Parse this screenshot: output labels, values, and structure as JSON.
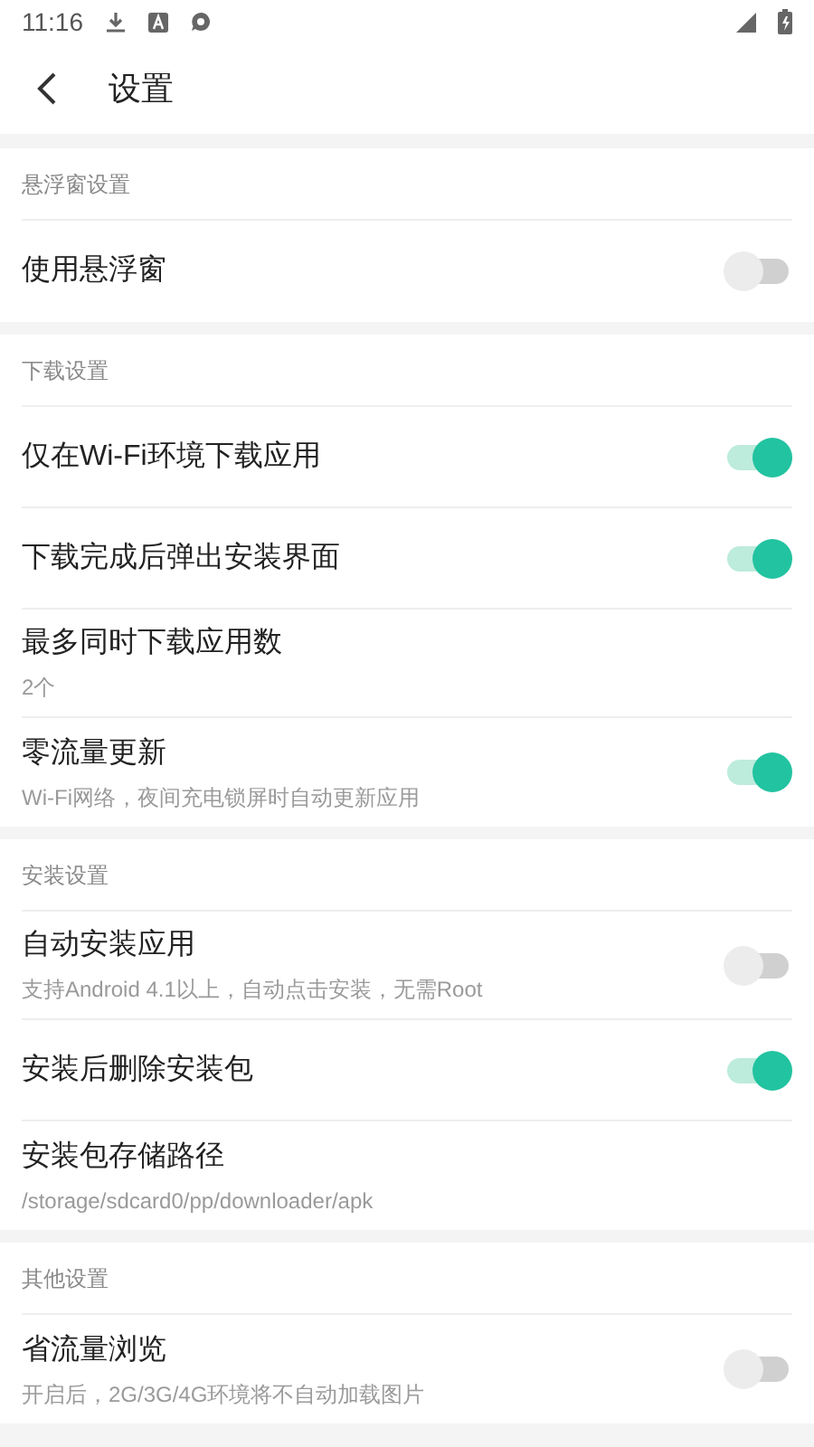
{
  "status_bar": {
    "time": "11:16"
  },
  "toolbar": {
    "title": "设置"
  },
  "sections": [
    {
      "title": "悬浮窗设置",
      "items": [
        {
          "kind": "switch",
          "label": "使用悬浮窗",
          "on": false
        }
      ]
    },
    {
      "title": "下载设置",
      "items": [
        {
          "kind": "switch",
          "label": "仅在Wi-Fi环境下载应用",
          "on": true
        },
        {
          "kind": "switch",
          "label": "下载完成后弹出安装界面",
          "on": true
        },
        {
          "kind": "info",
          "label": "最多同时下载应用数",
          "subtitle": "2个"
        },
        {
          "kind": "switch",
          "label": "零流量更新",
          "subtitle": "Wi-Fi网络，夜间充电锁屏时自动更新应用",
          "on": true
        }
      ]
    },
    {
      "title": "安装设置",
      "items": [
        {
          "kind": "switch",
          "label": "自动安装应用",
          "subtitle": "支持Android 4.1以上，自动点击安装，无需Root",
          "on": false
        },
        {
          "kind": "switch",
          "label": "安装后删除安装包",
          "on": true
        },
        {
          "kind": "info",
          "label": "安装包存储路径",
          "subtitle": "/storage/sdcard0/pp/downloader/apk"
        }
      ]
    },
    {
      "title": "其他设置",
      "items": [
        {
          "kind": "switch",
          "label": "省流量浏览",
          "subtitle": "开启后，2G/3G/4G环境将不自动加载图片",
          "on": false
        }
      ]
    }
  ]
}
